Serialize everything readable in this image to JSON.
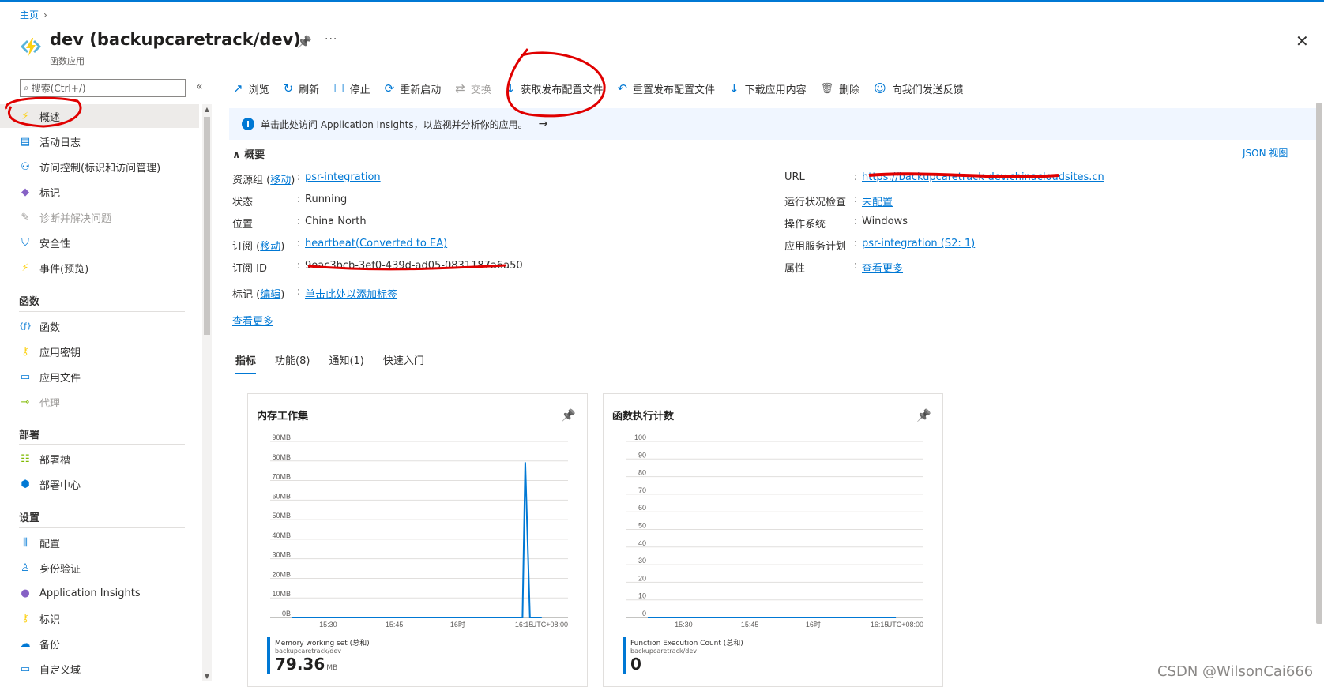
{
  "breadcrumb": {
    "home": "主页",
    "sep": "›"
  },
  "header": {
    "title": "dev (backupcaretrack/dev)",
    "subtitle": "函数应用",
    "pin": "📌",
    "more": "···",
    "close": "✕"
  },
  "search": {
    "placeholder": "搜索(Ctrl+/)",
    "icon": "⌕",
    "collapse": "«"
  },
  "sidebar": {
    "top_items": [
      {
        "label": "概述",
        "icon": "function-icon"
      },
      {
        "label": "活动日志",
        "icon": "log-icon"
      },
      {
        "label": "访问控制(标识和访问管理)",
        "icon": "people-icon"
      },
      {
        "label": "标记",
        "icon": "tag-icon"
      },
      {
        "label": "诊断并解决问题",
        "icon": "wrench-icon"
      },
      {
        "label": "安全性",
        "icon": "shield-icon"
      },
      {
        "label": "事件(预览)",
        "icon": "bolt-icon"
      }
    ],
    "sections": [
      {
        "title": "函数",
        "items": [
          {
            "label": "函数",
            "icon": "fx-icon"
          },
          {
            "label": "应用密钥",
            "icon": "key-icon"
          },
          {
            "label": "应用文件",
            "icon": "file-icon"
          },
          {
            "label": "代理",
            "icon": "proxy-icon"
          }
        ]
      },
      {
        "title": "部署",
        "items": [
          {
            "label": "部署槽",
            "icon": "slot-icon"
          },
          {
            "label": "部署中心",
            "icon": "cube-icon"
          }
        ]
      },
      {
        "title": "设置",
        "items": [
          {
            "label": "配置",
            "icon": "config-icon"
          },
          {
            "label": "身份验证",
            "icon": "user-icon"
          },
          {
            "label": "Application Insights",
            "icon": "insights-icon"
          },
          {
            "label": "标识",
            "icon": "identity-icon"
          },
          {
            "label": "备份",
            "icon": "backup-icon"
          },
          {
            "label": "自定义域",
            "icon": "domain-icon"
          }
        ]
      }
    ]
  },
  "toolbar": [
    {
      "label": "浏览",
      "icon": "↗"
    },
    {
      "label": "刷新",
      "icon": "↻"
    },
    {
      "label": "停止",
      "icon": "☐"
    },
    {
      "label": "重新启动",
      "icon": "⟳"
    },
    {
      "label": "交换",
      "icon": "⇄"
    },
    {
      "label": "获取发布配置文件",
      "icon": "↓"
    },
    {
      "label": "重置发布配置文件",
      "icon": "↶"
    },
    {
      "label": "下载应用内容",
      "icon": "↓"
    },
    {
      "label": "删除",
      "icon": "🗑"
    },
    {
      "label": "向我们发送反馈",
      "icon": "☺"
    }
  ],
  "banner": {
    "text": "单击此处访问 Application Insights，以监视并分析你的应用。",
    "arrow": "→",
    "icon": "i"
  },
  "essentials": {
    "heading": "概要",
    "json_view": "JSON 视图",
    "left": [
      {
        "key": "资源组",
        "key_link": "移动",
        "value": "psr-integration",
        "link": true
      },
      {
        "key": "状态",
        "value": "Running",
        "link": false
      },
      {
        "key": "位置",
        "value": "China North",
        "link": false
      },
      {
        "key": "订阅",
        "key_link": "移动",
        "value": "heartbeat(Converted to EA)",
        "link": true
      },
      {
        "key": "订阅 ID",
        "value": "9eac3bcb-3ef0-439d-ad05-0831187a6a50",
        "link": false
      },
      {
        "key": "标记",
        "key_link": "编辑",
        "value": "单击此处以添加标签",
        "link": true
      }
    ],
    "right": [
      {
        "key": "URL",
        "value": "https://backupcaretrack-dev.chinacloudsites.cn",
        "link": true
      },
      {
        "key": "运行状况检查",
        "value": "未配置",
        "link": true
      },
      {
        "key": "操作系统",
        "value": "Windows",
        "link": false
      },
      {
        "key": "应用服务计划",
        "value": "psr-integration (S2: 1)",
        "link": true
      },
      {
        "key": "属性",
        "value": "查看更多",
        "link": true
      }
    ],
    "see_more": "查看更多"
  },
  "tabs": [
    "指标",
    "功能(8)",
    "通知(1)",
    "快速入门"
  ],
  "chart_data": [
    {
      "type": "line",
      "title": "内存工作集",
      "yticks": [
        "0B",
        "10MB",
        "20MB",
        "30MB",
        "40MB",
        "50MB",
        "60MB",
        "70MB",
        "80MB",
        "90MB"
      ],
      "xticks": [
        "15:30",
        "15:45",
        "16时",
        "16:15",
        "UTC+08:00"
      ],
      "series": [
        {
          "name": "Memory working set (总和)",
          "resource": "backupcaretrack/dev",
          "total": "79.36",
          "unit": "MB",
          "x": [
            0,
            0.82,
            0.835,
            0.845,
            0.862,
            0.905
          ],
          "y": [
            0,
            0,
            0,
            79.36,
            0,
            0
          ]
        }
      ],
      "ylim": [
        0,
        90
      ]
    },
    {
      "type": "line",
      "title": "函数执行计数",
      "yticks": [
        "0",
        "10",
        "20",
        "30",
        "40",
        "50",
        "60",
        "70",
        "80",
        "90",
        "100"
      ],
      "xticks": [
        "15:30",
        "15:45",
        "16时",
        "16:15",
        "UTC+08:00"
      ],
      "series": [
        {
          "name": "Function Execution Count (总和)",
          "resource": "backupcaretrack/dev",
          "total": "0",
          "unit": "",
          "x": [
            0,
            0.9
          ],
          "y": [
            0,
            0
          ]
        }
      ],
      "ylim": [
        0,
        100
      ]
    }
  ],
  "watermark": "CSDN @WilsonCai666",
  "colors": {
    "accent": "#0078d4",
    "annotation": "#e00000"
  }
}
